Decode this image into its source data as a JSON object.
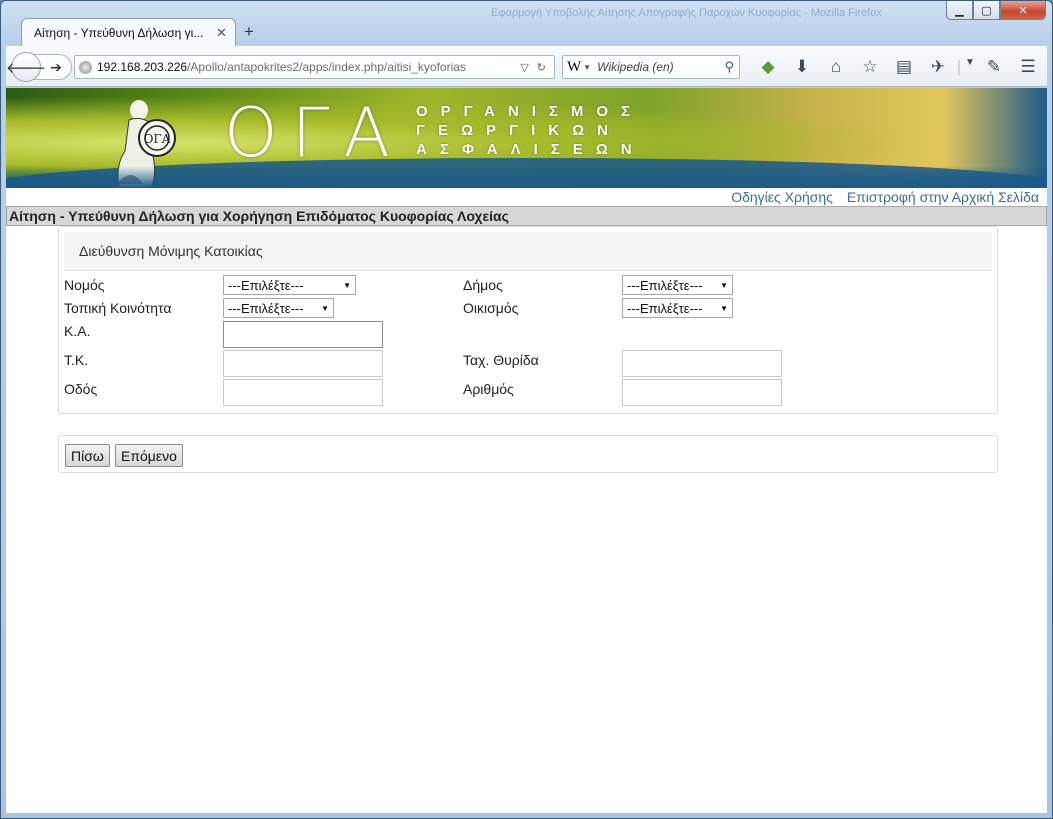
{
  "browser": {
    "background_window_title": "Εφαρμογή Υποβολής Αίτησης Απογραφής Παροχών Κυοφορίας - Mozilla Firefox",
    "tab_title": "Αίτηση - Υπεύθυνη Δήλωση γι...",
    "tab_close": "✕",
    "new_tab": "+",
    "url_host": "192.168.203.226",
    "url_path": "/Apollo/antapokrites2/apps/index.php/aitisi_kyoforias",
    "search_engine_logo": "W",
    "search_placeholder": "Wikipedia (en)",
    "toolbar_icons": [
      "sync-icon",
      "download-icon",
      "home-icon",
      "bookmark-star-icon",
      "reading-list-icon",
      "addon-icon",
      "dropdown-icon",
      "notepad-icon",
      "menu-icon"
    ]
  },
  "banner": {
    "logo_text": "ΟΓΑ",
    "subtitle_lines": [
      "ΟΡΓΑΝΙΣΜΟΣ",
      "ΓΕΩΡΓΙΚΩΝ",
      "ΑΣΦΑΛΙΣΕΩΝ"
    ]
  },
  "top_links": {
    "help": "Οδηγίες Χρήσης",
    "home": "Επιστροφή στην Αρχική Σελίδα"
  },
  "page_title": "Αίτηση - Υπεύθυνη Δήλωση για Χορήγηση Επιδόματος Κυοφορίας Λοχείας",
  "address_panel": {
    "heading": "Διεύθυνση Μόνιμης Κατοικίας",
    "fields": {
      "nomos_label": "Νομός",
      "nomos_value": "---Επιλέξτε---",
      "dimos_label": "Δήμος",
      "dimos_value": "---Επιλέξτε---",
      "koinotita_label": "Τοπική Κοινότητα",
      "koinotita_value": "---Επιλέξτε---",
      "oikismos_label": "Οικισμός",
      "oikismos_value": "---Επιλέξτε---",
      "ka_label": "Κ.Α.",
      "ka_value": "",
      "tk_label": "Τ.Κ.",
      "tk_value": "",
      "thyrida_label": "Ταχ. Θυρίδα",
      "thyrida_value": "",
      "odos_label": "Οδός",
      "odos_value": "",
      "arithmos_label": "Αριθμός",
      "arithmos_value": ""
    }
  },
  "buttons": {
    "back": "Πίσω",
    "next": "Επόμενο"
  }
}
